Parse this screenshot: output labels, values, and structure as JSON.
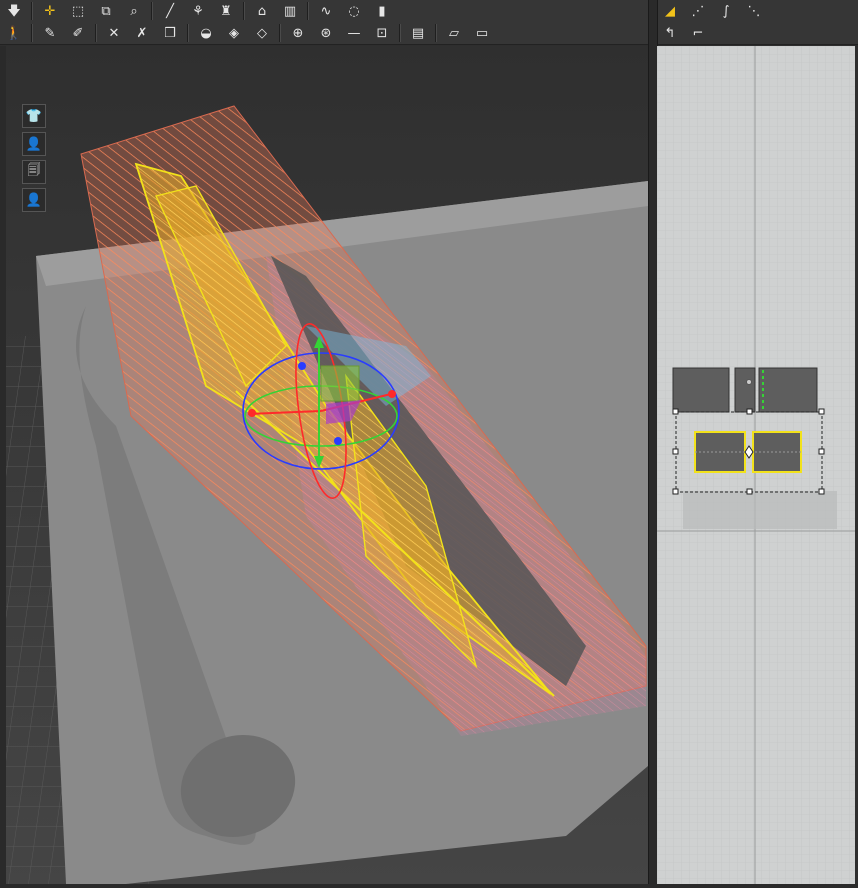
{
  "toolbar_top": {
    "icons": [
      "arrow-down-icon",
      "move-icon",
      "select-box-icon",
      "transform-box-icon",
      "edit-select-icon",
      "brush-icon",
      "fold-icon",
      "garment-icon",
      "tack-icon",
      "pin-icon",
      "rope-icon",
      "ring-icon",
      "zipper-icon"
    ],
    "active": "move-icon"
  },
  "toolbar_bottom": {
    "icons": [
      "avatar-pose-icon",
      "pin-tool-icon",
      "pin-edit-icon",
      "strap-icon",
      "fold-arrange-icon",
      "garment-shape-icon",
      "button-icon",
      "quilt-icon",
      "seam-icon",
      "line-icon",
      "circle-button-icon",
      "bar-icon",
      "lock-icon",
      "flat-panel-icon",
      "flat-board-icon"
    ]
  },
  "toolbar_2d": {
    "row1_icons": [
      "pattern-select-icon",
      "transform-pattern-icon",
      "curve-point-icon",
      "edit-point-icon"
    ],
    "row2_icons": [
      "undo-pattern-icon",
      "segment-icon"
    ],
    "active": "pattern-select-icon"
  },
  "side_tools": [
    "garment-display-icon",
    "avatar-display-icon",
    "pattern-display-icon",
    "avatar-head-icon"
  ],
  "colors": {
    "accent": "#f2c21a",
    "selection_yellow": "#f2e21a",
    "cloth_orange": "#e8906a",
    "gizmo_red": "#ff2a2a",
    "gizmo_green": "#35d335",
    "gizmo_blue": "#2a3cff",
    "grid_2d": "#cfd1d1"
  }
}
